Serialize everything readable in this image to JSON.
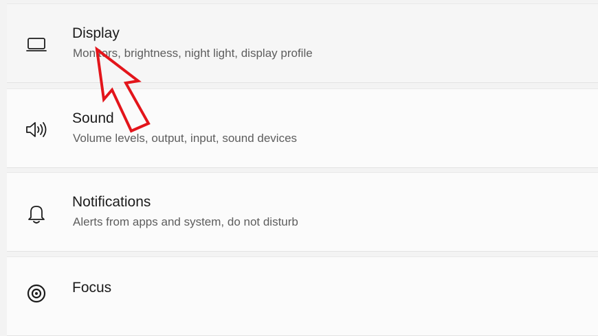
{
  "settings_list": {
    "items": [
      {
        "title": "Display",
        "subtitle": "Monitors, brightness, night light, display profile",
        "icon": "display-icon"
      },
      {
        "title": "Sound",
        "subtitle": "Volume levels, output, input, sound devices",
        "icon": "speaker-icon"
      },
      {
        "title": "Notifications",
        "subtitle": "Alerts from apps and system, do not disturb",
        "icon": "bell-icon"
      },
      {
        "title": "Focus",
        "icon": "focus-icon"
      }
    ]
  },
  "annotation": {
    "color": "#e3151b"
  }
}
